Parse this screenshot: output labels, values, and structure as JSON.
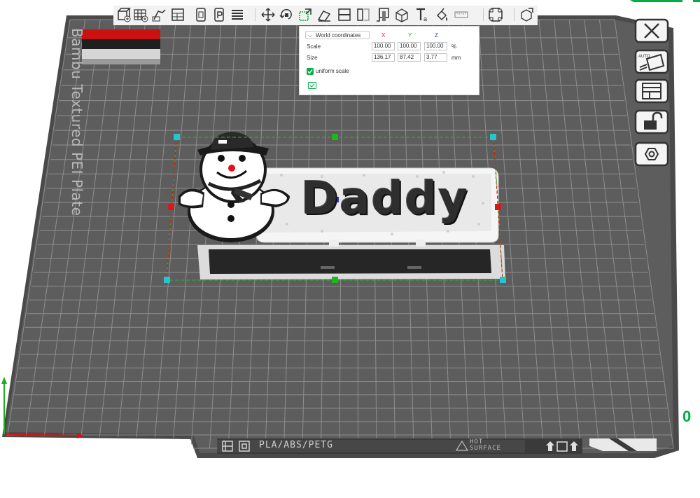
{
  "plate": {
    "name": "Bambu Textured PEI Plate"
  },
  "toolbar": {
    "items": [
      {
        "name": "add-object-icon"
      },
      {
        "name": "add-plate-icon"
      },
      {
        "name": "auto-orient-icon"
      },
      {
        "name": "arrange-icon"
      },
      {
        "name": "split-to-objects-icon"
      },
      {
        "name": "split-to-parts-icon"
      },
      {
        "name": "layers-icon"
      },
      {
        "name": "move-icon"
      },
      {
        "name": "rotate-icon"
      },
      {
        "name": "scale-icon"
      },
      {
        "name": "lay-on-face-icon"
      },
      {
        "name": "cut-icon"
      },
      {
        "name": "support-paint-icon"
      },
      {
        "name": "boolean-icon"
      },
      {
        "name": "text-icon"
      },
      {
        "name": "color-paint-icon"
      },
      {
        "name": "measure-icon"
      },
      {
        "name": "seam-paint-icon"
      },
      {
        "name": "fit-view-icon"
      },
      {
        "name": "assembly-icon"
      }
    ]
  },
  "scale_panel": {
    "coordinate_mode": "World coordinates",
    "axis_x": "X",
    "axis_y": "Y",
    "axis_z": "Z",
    "scale_label": "Scale",
    "size_label": "Size",
    "scale_x": "100.00",
    "scale_y": "100.00",
    "scale_z": "100.00",
    "scale_unit": "%",
    "size_x": "136.17",
    "size_y": "87.42",
    "size_z": "3.77",
    "size_unit": "mm",
    "uniform_scale_label": "uniform scale",
    "uniform_scale_checked": true
  },
  "side_toolbar": [
    {
      "name": "close-icon"
    },
    {
      "name": "auto-plate-icon"
    },
    {
      "name": "plate-layout-icon"
    },
    {
      "name": "lock-icon"
    },
    {
      "name": "settings-hex-icon"
    }
  ],
  "model": {
    "text": "Daddy"
  },
  "bottom_bar": {
    "filament": "PLA/ABS/PETG",
    "hot_line1": "HOT",
    "hot_line2": "SURFACE"
  },
  "edge_text": "0",
  "colors": {
    "accent": "#00ae42",
    "bed": "#5d5d5d",
    "grid": "#8a8a8a",
    "bed_border": "#4a4a4a",
    "handle_cyan": "#22c6cf",
    "handle_green": "#1eb81e",
    "handle_red": "#d41a1a"
  }
}
